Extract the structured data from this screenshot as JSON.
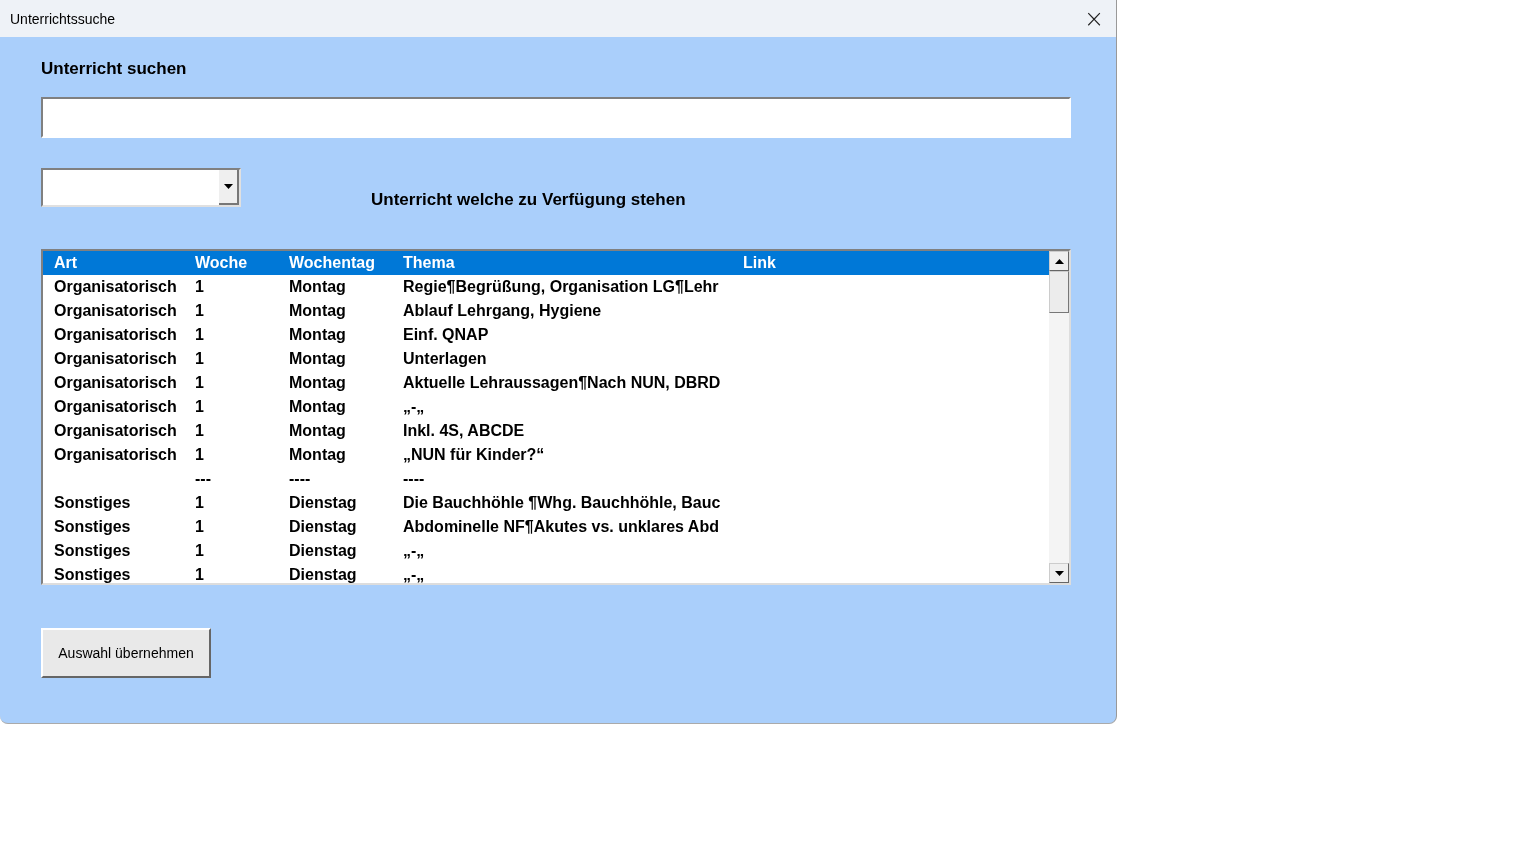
{
  "window": {
    "title": "Unterrichtssuche",
    "close": "×"
  },
  "search": {
    "label": "Unterricht suchen"
  },
  "list_title": "Unterricht welche zu Verfügung stehen",
  "list": {
    "rows": [
      {
        "cells": [
          "Art",
          "Woche",
          "Wochentag",
          "Thema",
          "Link"
        ],
        "selected": true
      },
      {
        "cells": [
          "Organisatorisch",
          "1",
          "Montag",
          "Regie¶Begrüßung, Organisation LG¶Lehr",
          null
        ],
        "selected": false
      },
      {
        "cells": [
          "Organisatorisch",
          "1",
          "Montag",
          "Ablauf Lehrgang, Hygiene",
          null
        ],
        "selected": false
      },
      {
        "cells": [
          "Organisatorisch",
          "1",
          "Montag",
          "Einf. QNAP",
          null
        ],
        "selected": false
      },
      {
        "cells": [
          "Organisatorisch",
          "1",
          "Montag",
          "Unterlagen",
          null
        ],
        "selected": false
      },
      {
        "cells": [
          "Organisatorisch",
          "1",
          "Montag",
          "Aktuelle Lehraussagen¶Nach NUN, DBRD",
          null
        ],
        "selected": false
      },
      {
        "cells": [
          "Organisatorisch",
          "1",
          "Montag",
          "„-„",
          null
        ],
        "selected": false
      },
      {
        "cells": [
          "Organisatorisch",
          "1",
          "Montag",
          "Inkl. 4S, ABCDE",
          null
        ],
        "selected": false
      },
      {
        "cells": [
          "Organisatorisch",
          "1",
          "Montag",
          "„NUN für Kinder?“",
          null
        ],
        "selected": false
      },
      {
        "cells": [
          null,
          "---",
          "----",
          "----",
          null
        ],
        "selected": false
      },
      {
        "cells": [
          "Sonstiges",
          "1",
          "Dienstag",
          "Die Bauchhöhle ¶Whg. Bauchhöhle, Bauc",
          null
        ],
        "selected": false
      },
      {
        "cells": [
          "Sonstiges",
          "1",
          "Dienstag",
          "Abdominelle NF¶Akutes vs. unklares Abd",
          null
        ],
        "selected": false
      },
      {
        "cells": [
          "Sonstiges",
          "1",
          "Dienstag",
          "„-„",
          null
        ],
        "selected": false
      },
      {
        "cells": [
          "Sonstiges",
          "1",
          "Dienstag",
          "„-„",
          null
        ],
        "selected": false
      }
    ]
  },
  "button": "Auswahl übernehmen"
}
